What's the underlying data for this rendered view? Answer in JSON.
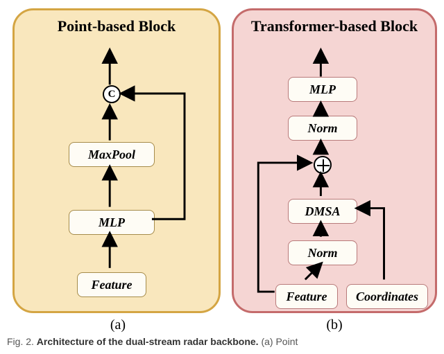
{
  "figure": {
    "number": "Fig. 2.",
    "title_bold": "Architecture of the dual-stream radar backbone.",
    "tail": " (a) Point"
  },
  "left": {
    "title": "Point-based Block",
    "sublabel": "(a)",
    "nodes": {
      "feature": "Feature",
      "mlp": "MLP",
      "maxpool": "MaxPool",
      "concat": "C"
    }
  },
  "right": {
    "title": "Transformer-based Block",
    "sublabel": "(b)",
    "nodes": {
      "feature": "Feature",
      "coords": "Coordinates",
      "norm1": "Norm",
      "dmsa": "DMSA",
      "norm2": "Norm",
      "mlp": "MLP"
    }
  }
}
